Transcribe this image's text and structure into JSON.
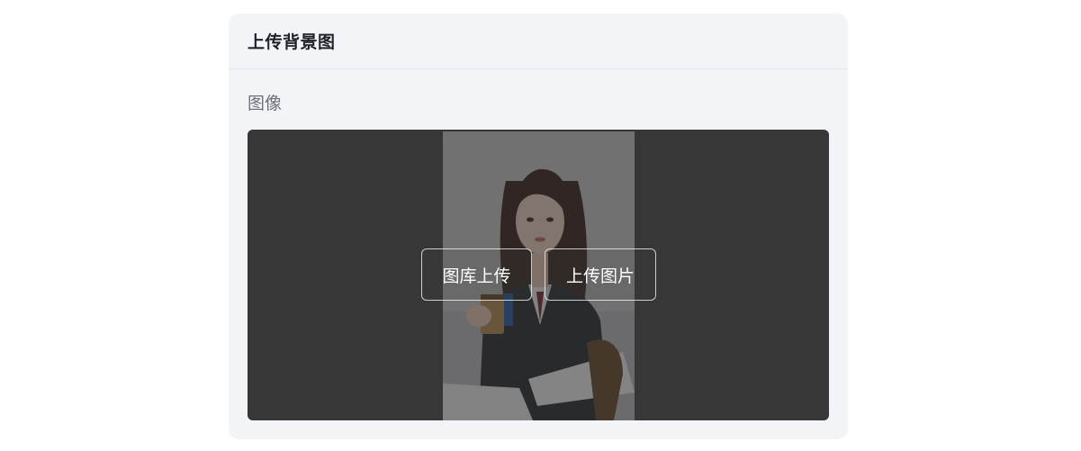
{
  "card": {
    "title": "上传背景图",
    "field_label": "图像"
  },
  "image_area": {
    "preview_alt": "",
    "gallery_button_label": "图库上传",
    "upload_button_label": "上传图片"
  },
  "colors": {
    "card_bg": "#f3f4f8",
    "image_area_bg": "#4b4b4b",
    "title_text": "#1f2329",
    "label_text": "#6b6f78"
  }
}
